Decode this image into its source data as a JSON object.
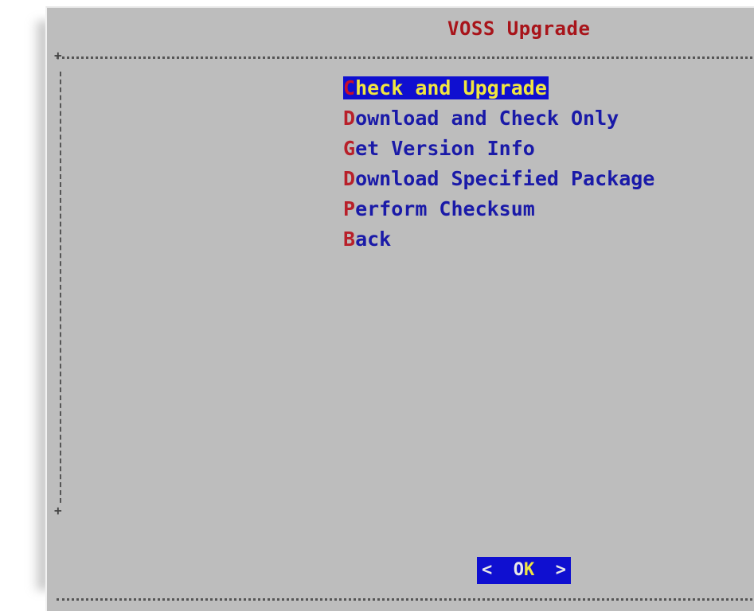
{
  "dialog": {
    "title": "VOSS Upgrade",
    "menu": [
      {
        "hotkey": "C",
        "rest": "heck and Upgrade",
        "selected": true
      },
      {
        "hotkey": "D",
        "rest": "ownload and Check Only",
        "selected": false
      },
      {
        "hotkey": "G",
        "rest": "et Version Info",
        "selected": false
      },
      {
        "hotkey": "D",
        "rest": "ownload Specified Package",
        "selected": false
      },
      {
        "hotkey": "P",
        "rest": "erform Checksum",
        "selected": false
      },
      {
        "hotkey": "B",
        "rest": "ack",
        "selected": false
      }
    ],
    "ok_button": {
      "left_bracket": "<",
      "label_first": "O",
      "label_rest": "K",
      "right_bracket": ">"
    }
  },
  "colors": {
    "background": "#bdbdbd",
    "title": "#a8141a",
    "menu_text": "#1a1aa8",
    "hotkey": "#b8202a",
    "selection_bg": "#0f0fd0",
    "selection_text": "#f0e640"
  }
}
